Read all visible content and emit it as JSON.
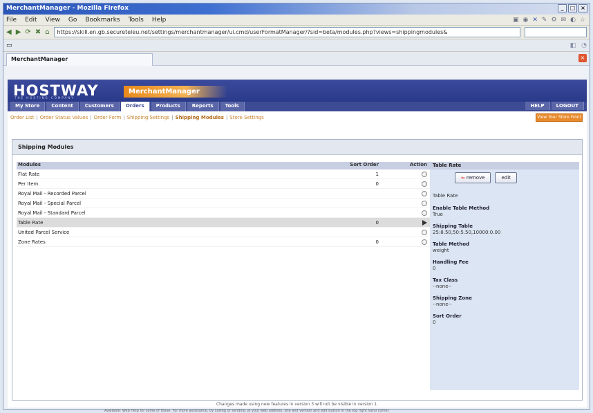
{
  "window": {
    "title": "MerchantManager - Mozilla Firefox",
    "ctrl_min": "_",
    "ctrl_max": "□",
    "ctrl_close": "×"
  },
  "menubar": {
    "items": [
      "File",
      "Edit",
      "View",
      "Go",
      "Bookmarks",
      "Tools",
      "Help"
    ]
  },
  "navbar": {
    "url": "https://skill.en.gb.secureteleu.net/settings/merchantmanager/ui.cmd/userFormatManager/?sid=beta/modules.php?views=shippingmodules&",
    "back": "◀",
    "forward": "▶",
    "reload": "⟳",
    "stop": "✖",
    "home": "⌂"
  },
  "tab": {
    "label": "MerchantManager",
    "close": "×"
  },
  "brand": {
    "logo": "HOSTWAY",
    "logo_sub": "THE HOSTING COMPANY",
    "product_part1": "Merchant",
    "product_part2": "Manager"
  },
  "mainnav": {
    "items": [
      "My Store",
      "Content",
      "Customers",
      "Orders",
      "Products",
      "Reports",
      "Tools"
    ],
    "active": "Orders",
    "help": "HELP",
    "logout": "LOGOUT"
  },
  "subnav": {
    "items": [
      "Order List",
      "Order Status Values",
      "Order Form",
      "Shipping Settings",
      "Shipping Modules",
      "Store Settings"
    ],
    "current": "Shipping Modules",
    "store_button": "View Your Store Front"
  },
  "panel": {
    "title": "Shipping Modules",
    "columns": {
      "module": "Modules",
      "sort": "Sort Order",
      "action": "Action"
    },
    "rows": [
      {
        "module": "Flat Rate",
        "sort": "1",
        "action": "circle"
      },
      {
        "module": "Per Item",
        "sort": "0",
        "action": "circle"
      },
      {
        "module": "Royal Mail - Recorded Parcel",
        "sort": "",
        "action": "circle"
      },
      {
        "module": "Royal Mail - Special Parcel",
        "sort": "",
        "action": "circle"
      },
      {
        "module": "Royal Mail - Standard Parcel",
        "sort": "",
        "action": "circle"
      },
      {
        "module": "Table Rate",
        "sort": "0",
        "action": "arrow"
      },
      {
        "module": "United Parcel Service",
        "sort": "",
        "action": "circle"
      },
      {
        "module": "Zone Rates",
        "sort": "0",
        "action": "circle"
      }
    ],
    "selected_index": 5
  },
  "sidebar": {
    "header": "Table Rate",
    "remove_label": "remove",
    "edit_label": "edit",
    "module_name": "Table Rate",
    "props": [
      {
        "label": "Enable Table Method",
        "value": "True"
      },
      {
        "label": "Shipping Table",
        "value": "25:8.50,50:5.50,10000:0.00"
      },
      {
        "label": "Table Method",
        "value": "weight"
      },
      {
        "label": "Handling Fee",
        "value": "0"
      },
      {
        "label": "Tax Class",
        "value": "--none--"
      },
      {
        "label": "Shipping Zone",
        "value": "--none--"
      },
      {
        "label": "Sort Order",
        "value": "0"
      }
    ]
  },
  "footer": {
    "line1": "Changes made using new features in version 3 will not be visible in version 1.",
    "line2": "Available: Web Help for some of these. For more assistance, by calling or sending us your web address, site and version and edit button in the top right hand corner."
  }
}
